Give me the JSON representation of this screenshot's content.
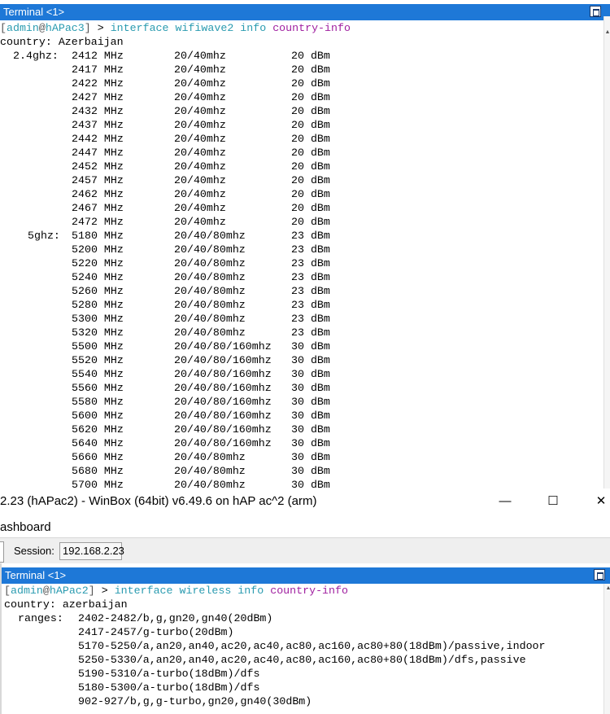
{
  "terminal1": {
    "title": "Terminal <1>",
    "prompt": {
      "open": "[",
      "user": "admin",
      "at": "@",
      "host": "hAPac3",
      "close": "]",
      "arrow": " > ",
      "command": "interface wifiwave2 info",
      "argument": "country-info"
    },
    "country_line": "country: Azerbaijan",
    "band_24_label": "2.4ghz:",
    "band_5_label": "5ghz:",
    "rows": [
      {
        "freq": "2412 MHz",
        "width": "20/40mhz",
        "power": "20 dBm"
      },
      {
        "freq": "2417 MHz",
        "width": "20/40mhz",
        "power": "20 dBm"
      },
      {
        "freq": "2422 MHz",
        "width": "20/40mhz",
        "power": "20 dBm"
      },
      {
        "freq": "2427 MHz",
        "width": "20/40mhz",
        "power": "20 dBm"
      },
      {
        "freq": "2432 MHz",
        "width": "20/40mhz",
        "power": "20 dBm"
      },
      {
        "freq": "2437 MHz",
        "width": "20/40mhz",
        "power": "20 dBm"
      },
      {
        "freq": "2442 MHz",
        "width": "20/40mhz",
        "power": "20 dBm"
      },
      {
        "freq": "2447 MHz",
        "width": "20/40mhz",
        "power": "20 dBm"
      },
      {
        "freq": "2452 MHz",
        "width": "20/40mhz",
        "power": "20 dBm"
      },
      {
        "freq": "2457 MHz",
        "width": "20/40mhz",
        "power": "20 dBm"
      },
      {
        "freq": "2462 MHz",
        "width": "20/40mhz",
        "power": "20 dBm"
      },
      {
        "freq": "2467 MHz",
        "width": "20/40mhz",
        "power": "20 dBm"
      },
      {
        "freq": "2472 MHz",
        "width": "20/40mhz",
        "power": "20 dBm"
      },
      {
        "freq": "5180 MHz",
        "width": "20/40/80mhz",
        "power": "23 dBm"
      },
      {
        "freq": "5200 MHz",
        "width": "20/40/80mhz",
        "power": "23 dBm"
      },
      {
        "freq": "5220 MHz",
        "width": "20/40/80mhz",
        "power": "23 dBm"
      },
      {
        "freq": "5240 MHz",
        "width": "20/40/80mhz",
        "power": "23 dBm"
      },
      {
        "freq": "5260 MHz",
        "width": "20/40/80mhz",
        "power": "23 dBm"
      },
      {
        "freq": "5280 MHz",
        "width": "20/40/80mhz",
        "power": "23 dBm"
      },
      {
        "freq": "5300 MHz",
        "width": "20/40/80mhz",
        "power": "23 dBm"
      },
      {
        "freq": "5320 MHz",
        "width": "20/40/80mhz",
        "power": "23 dBm"
      },
      {
        "freq": "5500 MHz",
        "width": "20/40/80/160mhz",
        "power": "30 dBm"
      },
      {
        "freq": "5520 MHz",
        "width": "20/40/80/160mhz",
        "power": "30 dBm"
      },
      {
        "freq": "5540 MHz",
        "width": "20/40/80/160mhz",
        "power": "30 dBm"
      },
      {
        "freq": "5560 MHz",
        "width": "20/40/80/160mhz",
        "power": "30 dBm"
      },
      {
        "freq": "5580 MHz",
        "width": "20/40/80/160mhz",
        "power": "30 dBm"
      },
      {
        "freq": "5600 MHz",
        "width": "20/40/80/160mhz",
        "power": "30 dBm"
      },
      {
        "freq": "5620 MHz",
        "width": "20/40/80/160mhz",
        "power": "30 dBm"
      },
      {
        "freq": "5640 MHz",
        "width": "20/40/80/160mhz",
        "power": "30 dBm"
      },
      {
        "freq": "5660 MHz",
        "width": "20/40/80mhz",
        "power": "30 dBm"
      },
      {
        "freq": "5680 MHz",
        "width": "20/40/80mhz",
        "power": "30 dBm"
      },
      {
        "freq": "5700 MHz",
        "width": "20/40/80mhz",
        "power": "30 dBm"
      }
    ]
  },
  "winbox": {
    "title": "2.23 (hAPac2) - WinBox (64bit) v6.49.6 on hAP ac^2 (arm)",
    "minimize_glyph": "—",
    "maximize_glyph": "☐",
    "close_glyph": "✕",
    "dashboard_label": "ashboard",
    "session_label": "Session:",
    "session_value": "192.168.2.23"
  },
  "terminal2": {
    "title": "Terminal <1>",
    "prompt": {
      "open": "[",
      "user": "admin",
      "at": "@",
      "host": "hAPac2",
      "close": "]",
      "arrow": " > ",
      "command": "interface wireless info",
      "argument": "country-info"
    },
    "country_line": "country: azerbaijan",
    "ranges_label": "ranges:",
    "ranges": [
      "2402-2482/b,g,gn20,gn40(20dBm)",
      "2417-2457/g-turbo(20dBm)",
      "5170-5250/a,an20,an40,ac20,ac40,ac80,ac160,ac80+80(18dBm)/passive,indoor",
      "5250-5330/a,an20,an40,ac20,ac40,ac80,ac160,ac80+80(18dBm)/dfs,passive",
      "5190-5310/a-turbo(18dBm)/dfs",
      "5180-5300/a-turbo(18dBm)/dfs",
      "902-927/b,g,g-turbo,gn20,gn40(30dBm)"
    ]
  },
  "colors": {
    "titlebar": "#1e78d7",
    "prompt_cyan": "#2a9bb0",
    "argument_magenta": "#a020a0"
  }
}
